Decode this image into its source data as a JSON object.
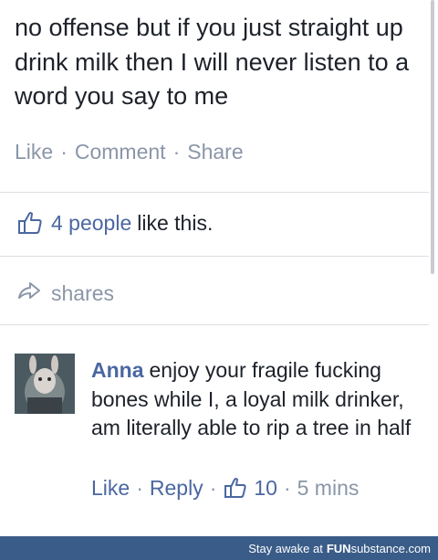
{
  "post": {
    "text": "no offense but if you just straight up drink milk then I will never listen to a word you say to me",
    "actions": {
      "like": "Like",
      "comment": "Comment",
      "share": "Share",
      "separator": "·"
    }
  },
  "likes": {
    "icon": "thumbs-up-icon",
    "people": "4 people",
    "suffix": "like this."
  },
  "shares": {
    "icon": "share-arrow-icon",
    "label": "shares"
  },
  "comment": {
    "author": "Anna",
    "text": "enjoy your fragile fucking bones while I, a loyal milk drinker, am literally able to rip a tree in half",
    "actions": {
      "like": "Like",
      "reply": "Reply",
      "separator": "·",
      "like_icon": "thumbs-up-icon",
      "like_count": "10",
      "time": "5 mins"
    }
  },
  "watermark": {
    "text": "Stay awake at",
    "brand_bold": "FUN",
    "brand_rest": "substance",
    "domain": ".com"
  },
  "colors": {
    "link_blue": "#4b67a1",
    "muted_gray": "#8a96a8",
    "text_dark": "#1d2129",
    "footer_bg": "#3a5c88"
  }
}
